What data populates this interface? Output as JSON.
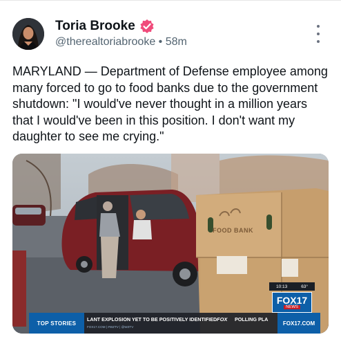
{
  "author": {
    "name": "Toria Brooke",
    "handle": "@therealtoriabrooke",
    "separator": "•",
    "time": "58m"
  },
  "post": {
    "text": "MARYLAND — Department of Defense employee among many forced to go to food banks due to the government shutdown: \"I would've never thought in a million years that I would've been in this position. I don't want my daughter to see me crying.\""
  },
  "media": {
    "box_label": "FOOD BANK",
    "clock_time": "10:13",
    "clock_temp": "63°",
    "station_logo": "FOX17",
    "station_logo_sub": "NEWS",
    "ticker_section": "TOP STORIES",
    "ticker_headline": "LANT EXPLOSION YET TO BE POSITIVELY IDENTIFIED",
    "ticker_subline": "FOX17.COM | #WZTV | @WZTV",
    "ticker_network": "FOX",
    "ticker_headline_2": "POLLING PLA",
    "ticker_site": "FOX17.COM"
  },
  "colors": {
    "verified_badge": "#f04b7b",
    "handle_gray": "#536471",
    "fox_blue": "#0d5fa8"
  },
  "icons": [
    "verified-badge-icon",
    "more-options-icon"
  ]
}
